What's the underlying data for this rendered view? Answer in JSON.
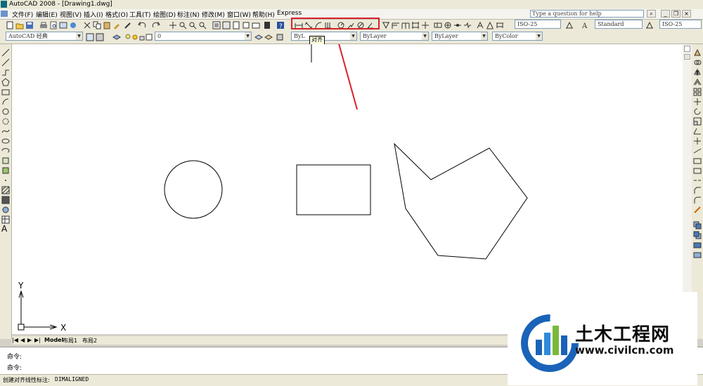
{
  "window": {
    "title": "AutoCAD 2008 - [Drawing1.dwg]"
  },
  "menu": {
    "items": [
      "文件(F)",
      "编辑(E)",
      "视图(V)",
      "插入(I)",
      "格式(O)",
      "工具(T)",
      "绘图(D)",
      "标注(N)",
      "修改(M)",
      "窗口(W)",
      "帮助(H)",
      "Express"
    ],
    "help_placeholder": "Type a question for help"
  },
  "toolbar": {
    "dimstyle": "ISO-25",
    "textstyle": "Standard",
    "tablestyle": "ISO-25",
    "workspace": "AutoCAD 经典",
    "layer": "0",
    "color": "ByL",
    "linetype": "ByLayer",
    "lineweight": "ByLayer",
    "plotstyle": "ByColor",
    "tooltip": "对齐"
  },
  "colors": {
    "highlight": "#d9222a",
    "canvas": "#ffffff"
  },
  "canvas": {
    "ucs_x": "X",
    "ucs_y": "Y"
  },
  "tabs": [
    "Model",
    "布局1",
    "布局2"
  ],
  "command": {
    "line1": "命令:",
    "line2": "命令:"
  },
  "status": {
    "text": "创建对齐线性标注:",
    "command": "DIMALIGNED"
  },
  "watermark": {
    "name": "土木工程网",
    "url": "www.civilcn.com"
  }
}
